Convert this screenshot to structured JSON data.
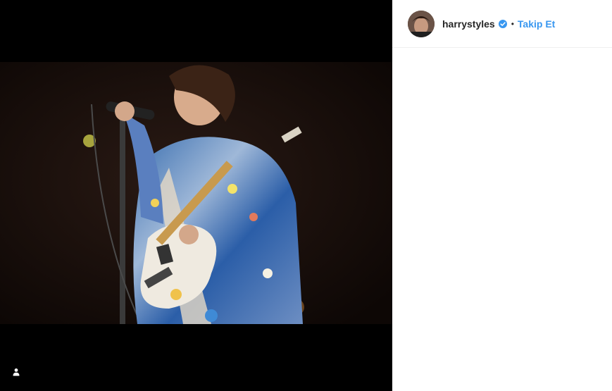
{
  "post": {
    "username": "harrystyles",
    "verified_icon": "verified-badge-icon",
    "separator": "•",
    "follow_label": "Takip Et"
  },
  "media": {
    "subject": "musician-with-guitar-and-microphone",
    "tag_icon": "user-tag-icon"
  },
  "colors": {
    "accent": "#3897f0",
    "text": "#262626",
    "media_bg": "#000000"
  }
}
